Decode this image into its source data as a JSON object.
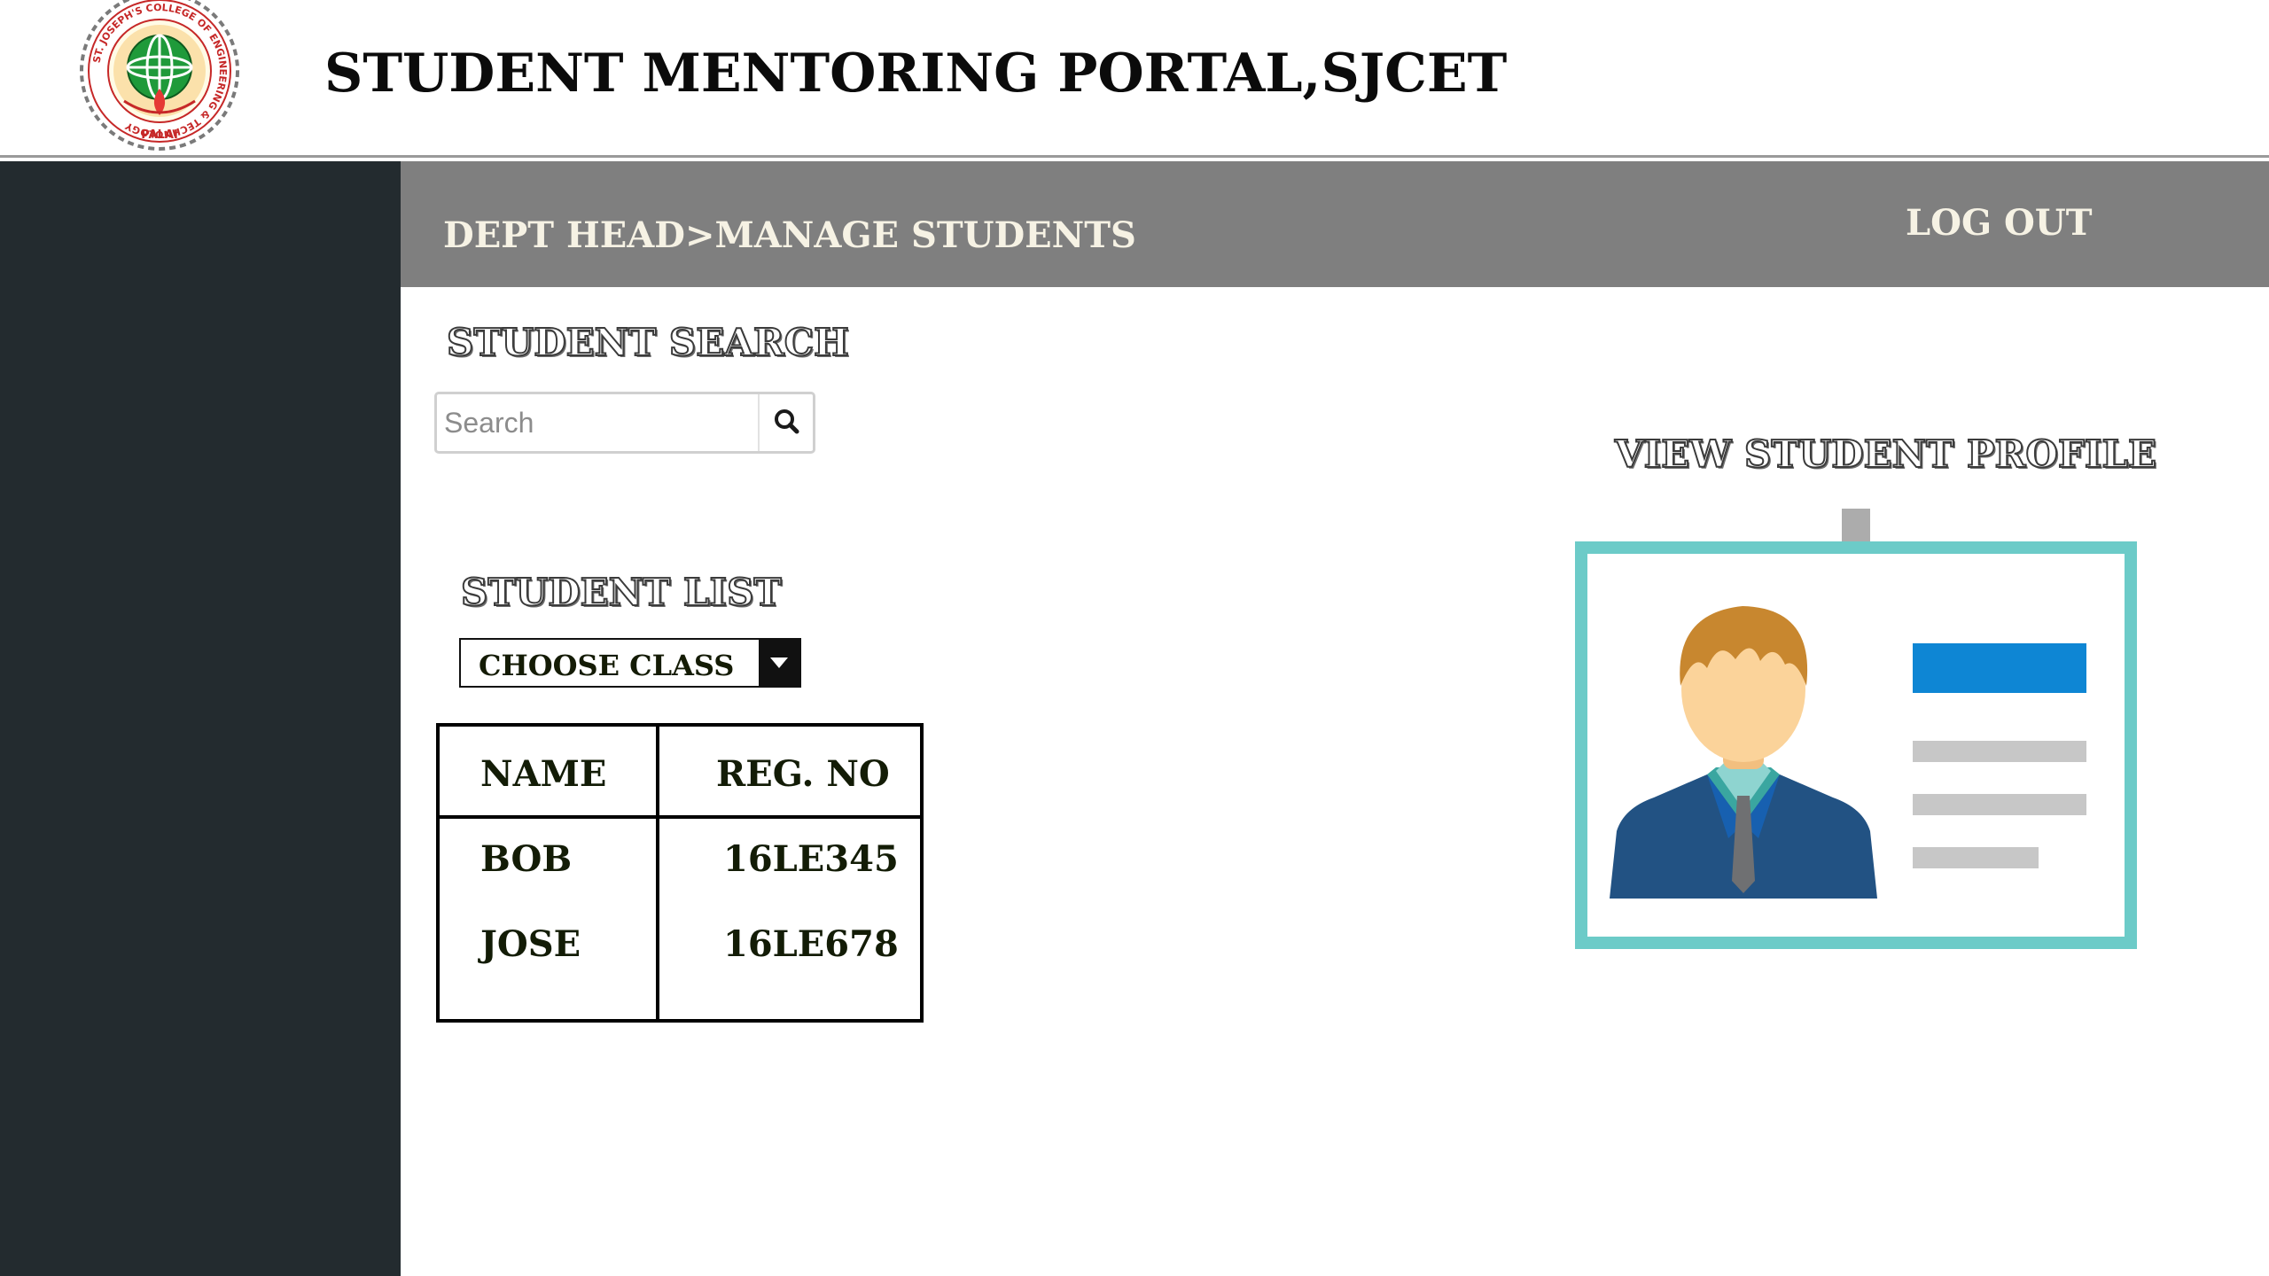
{
  "header": {
    "title": "STUDENT MENTORING PORTAL,SJCET",
    "logo": {
      "ring_text": "ST. JOSEPH'S COLLEGE OF ENGINEERING & TECHNOLOGY",
      "bottom_text": "PALAI"
    }
  },
  "topbar": {
    "breadcrumb": "DEPT HEAD>MANAGE STUDENTS",
    "logout_label": "LOG OUT"
  },
  "student_search": {
    "heading": "STUDENT SEARCH",
    "placeholder": "Search",
    "value": "",
    "button_icon": "search-icon"
  },
  "student_list": {
    "heading": "STUDENT LIST",
    "class_select": {
      "selected": "CHOOSE CLASS",
      "icon": "caret-down-icon"
    },
    "table": {
      "columns": [
        "NAME",
        "REG. NO"
      ],
      "rows": [
        {
          "name": "BOB",
          "reg_no": "16LE345"
        },
        {
          "name": "JOSE",
          "reg_no": "16LE678"
        }
      ]
    }
  },
  "profile": {
    "heading": "VIEW STUDENT PROFILE",
    "icon": "id-card-icon"
  },
  "colors": {
    "sidebar": "#232b2f",
    "topbar": "#7f7f7f",
    "topbar_text": "#f6f2e4",
    "card_border": "#6ccbc8",
    "card_accent": "#0e86d4"
  }
}
